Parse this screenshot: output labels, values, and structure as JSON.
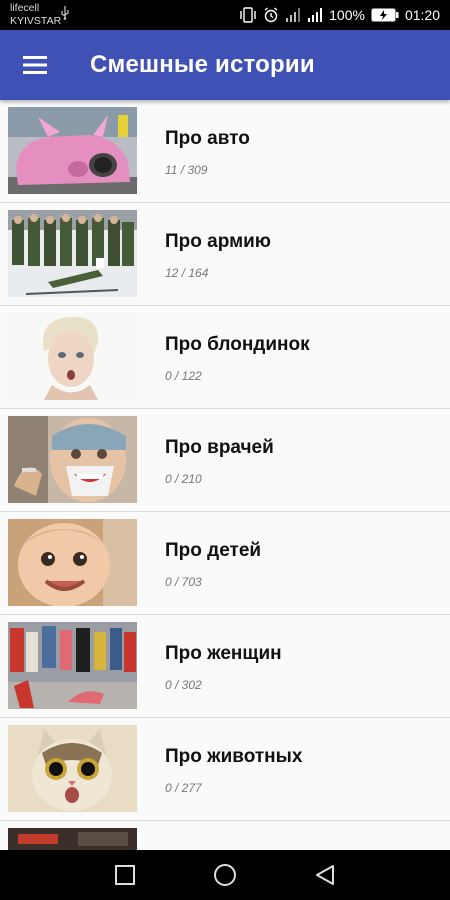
{
  "status_bar": {
    "carrier_line1": "lifecell",
    "carrier_line2": "KYIVSTAR",
    "battery": "100%",
    "time": "01:20",
    "icons": [
      "usb-icon",
      "vibrate-icon",
      "alarm-icon",
      "signal-icon",
      "signal-icon",
      "battery-icon"
    ]
  },
  "app_bar": {
    "title": "Смешные истории",
    "menu_icon": "hamburger-menu-icon",
    "color": "#3f51b5"
  },
  "categories": [
    {
      "title": "Про авто",
      "count": "11 / 309",
      "image": "pink-car-photo"
    },
    {
      "title": "Про армию",
      "count": "12 / 164",
      "image": "soldiers-photo"
    },
    {
      "title": "Про блондинок",
      "count": "0 / 122",
      "image": "blonde-photo"
    },
    {
      "title": "Про врачей",
      "count": "0 / 210",
      "image": "doctor-photo"
    },
    {
      "title": "Про детей",
      "count": "0 / 703",
      "image": "baby-photo"
    },
    {
      "title": "Про женщин",
      "count": "0 / 302",
      "image": "women-running-photo"
    },
    {
      "title": "Про животных",
      "count": "0 / 277",
      "image": "surprised-cat-photo"
    },
    {
      "title": "",
      "count": "",
      "image": "partial-photo"
    }
  ],
  "nav_bar": {
    "icons": [
      "recents-square-icon",
      "home-circle-icon",
      "back-triangle-icon"
    ]
  }
}
